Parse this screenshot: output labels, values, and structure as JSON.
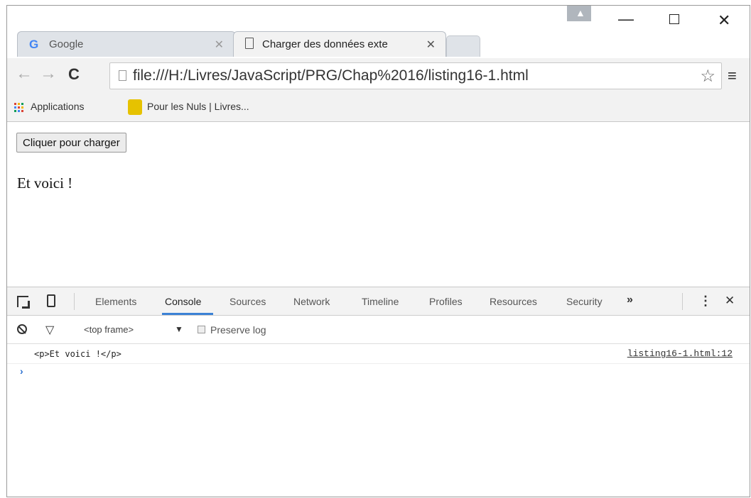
{
  "tabs": [
    {
      "label": "Google",
      "favicon": "G"
    },
    {
      "label": "Charger des données exte"
    }
  ],
  "window": {
    "minimize": "—",
    "close": "✕"
  },
  "toolbar": {
    "url": "file:///H:/Livres/JavaScript/PRG/Chap%2016/listing16-1.html",
    "back": "←",
    "forward": "→",
    "reload": "C",
    "star": "☆",
    "menu": "≡"
  },
  "bookmarks": [
    {
      "label": "Applications"
    },
    {
      "label": "Pour les Nuls | Livres..."
    }
  ],
  "page": {
    "button_label": "Cliquer pour charger",
    "text": "Et voici !"
  },
  "devtools": {
    "tabs": [
      "Elements",
      "Console",
      "Sources",
      "Network",
      "Timeline",
      "Profiles",
      "Resources",
      "Security"
    ],
    "active_tab": "Console",
    "more": "»",
    "menu": "⋮",
    "close": "✕",
    "frame": "<top frame>",
    "frame_arrow": "▼",
    "preserve_log": "Preserve log",
    "log": {
      "message": "<p>Et voici !</p>",
      "source": "listing16-1.html:12"
    },
    "prompt": "›"
  },
  "colors": {
    "accent": "#3c82d6",
    "google_blue": "#4285f4"
  }
}
